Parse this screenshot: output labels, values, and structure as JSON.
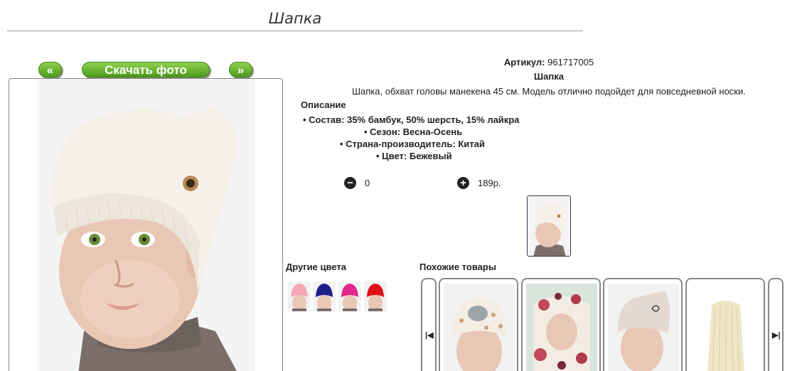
{
  "page": {
    "title": "Шапка"
  },
  "gallery": {
    "prev_label": "«",
    "download_label": "Скачать фото",
    "next_label": "»"
  },
  "product": {
    "article_label": "Артикул:",
    "article_value": "961717005",
    "name": "Шапка",
    "description": "Шапка, обхват головы манекена 45 см. Модель отлично подойдет для повседневной носки.",
    "description_heading": "Описание",
    "properties": [
      "Состав: 35% бамбук, 50% шерсть, 15% лайкра",
      "Сезон: Весна-Осень",
      "Страна-производитель: Китай",
      "Цвет: Бежевый"
    ]
  },
  "cart": {
    "minus_icon": "minus-circle-icon",
    "quantity": "0",
    "plus_icon": "plus-circle-icon",
    "price": "189р."
  },
  "other_colors": {
    "label": "Другие цвета",
    "swatches": [
      "#f4a6b8",
      "#1c1f8c",
      "#e0288e",
      "#e0101a"
    ]
  },
  "similar": {
    "label": "Похожие товары",
    "prev_icon": "skip-back-icon",
    "next_icon": "skip-forward-icon"
  },
  "colors": {
    "button_green": "#5aa91f",
    "hat_main": "#f5f1ea",
    "border": "#888888"
  }
}
